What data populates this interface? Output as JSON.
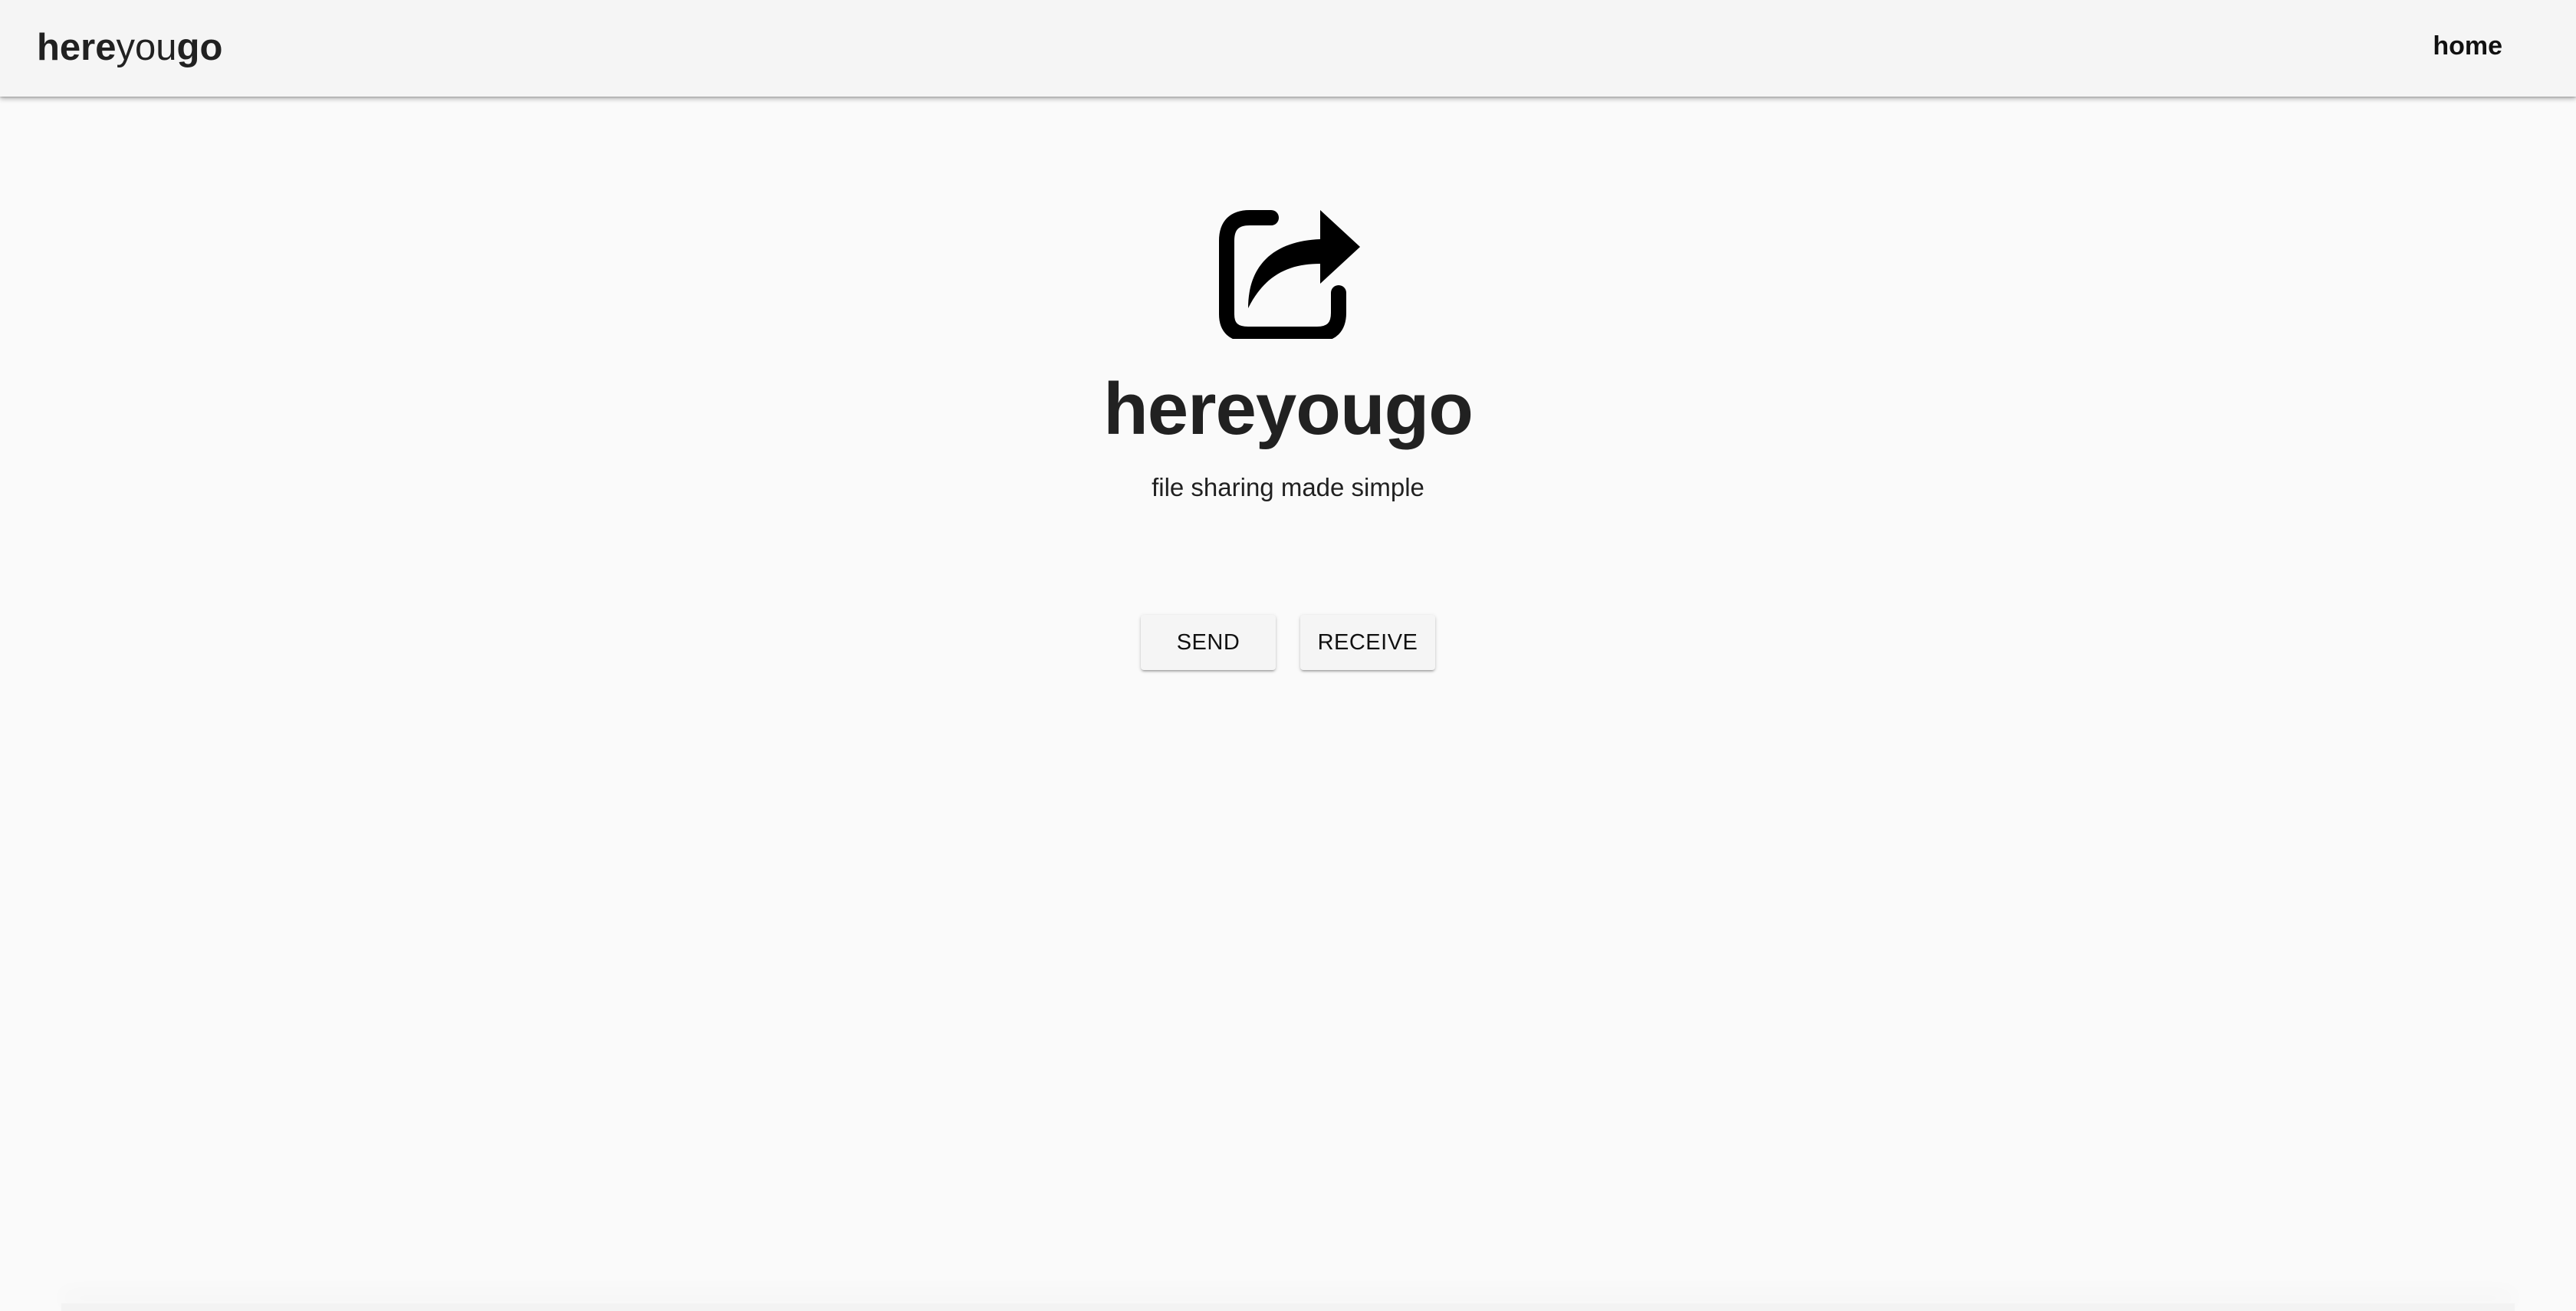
{
  "header": {
    "brand": {
      "part1": "here",
      "part2": "you",
      "part3": "go"
    },
    "nav": {
      "home": "home"
    }
  },
  "hero": {
    "icon": "share-icon",
    "title": "hereyougo",
    "subtitle": "file sharing made simple"
  },
  "actions": {
    "send_label": "SEND",
    "receive_label": "RECEIVE"
  },
  "colors": {
    "background": "#fafafa",
    "topbar": "#f5f5f5",
    "text": "#212121",
    "button": "#f5f5f5"
  }
}
